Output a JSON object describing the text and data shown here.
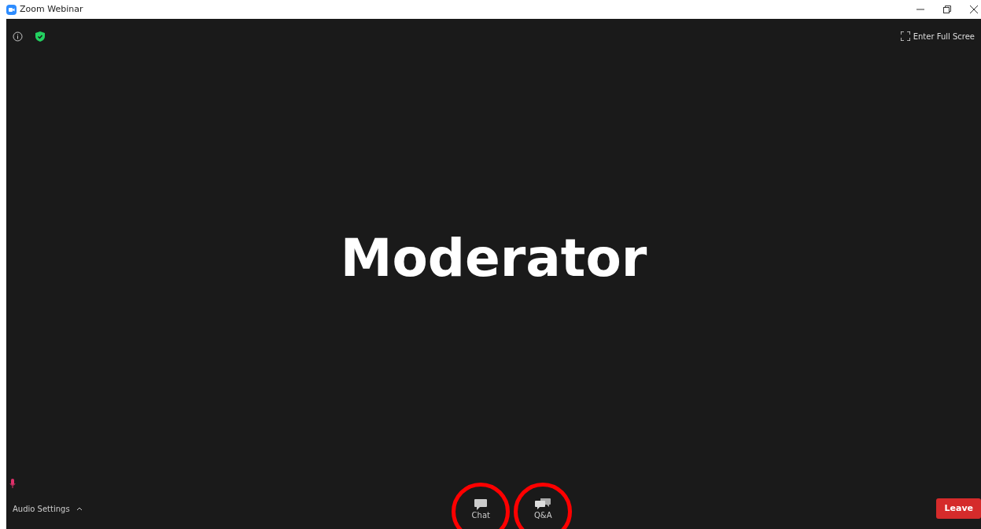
{
  "window": {
    "title": "Zoom Webinar"
  },
  "top_bar": {
    "full_screen_label": "Enter Full Scree"
  },
  "speaker": {
    "name": "Moderator"
  },
  "toolbar": {
    "audio_settings": "Audio Settings",
    "buttons": [
      {
        "label": "Chat",
        "kind": "chat",
        "highlighted": true
      },
      {
        "label": "Q&A",
        "kind": "qa",
        "highlighted": true
      }
    ],
    "leave": "Leave"
  }
}
